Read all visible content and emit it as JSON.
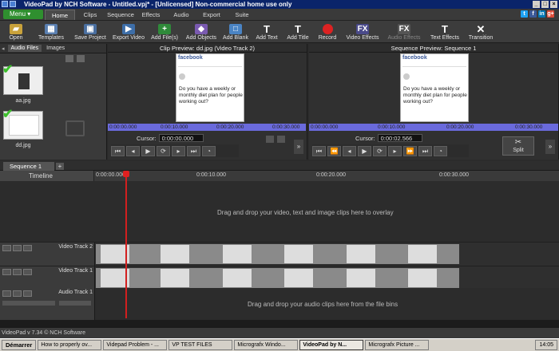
{
  "window": {
    "title": "VideoPad by NCH Software - Untitled.vpj* - [Unlicensed] Non-commercial home use only",
    "controls": [
      "_",
      "□",
      "×"
    ]
  },
  "menubar": {
    "menu_label": "Menu ▾",
    "tabs": [
      "Home",
      "Clips",
      "Sequence",
      "Effects",
      "Audio",
      "Export",
      "Suite"
    ],
    "social": [
      "t",
      "f",
      "in",
      "g+"
    ]
  },
  "toolbar": {
    "items": [
      "Open",
      "Templates",
      "Save Project",
      "Export Video",
      "Add File(s)",
      "Add Objects",
      "Add Blank",
      "Add Text",
      "Add Title",
      "Record",
      "Video Effects",
      "Audio Effects",
      "Text Effects",
      "Transition"
    ]
  },
  "filebin": {
    "tabs": [
      "Audio Files",
      "Images"
    ],
    "files": [
      "aa.jpg",
      "dd.jpg"
    ]
  },
  "clip_preview": {
    "title": "Clip Preview: dd.jpg (Video Track 2)",
    "ruler": [
      "0:00:00.000",
      "0:00:10.000",
      "0:00:20.000",
      "0:00:30.000"
    ],
    "cursor_label": "Cursor:",
    "cursor_value": "0:00:00.000"
  },
  "seq_preview": {
    "title": "Sequence Preview: Sequence 1",
    "ruler": [
      "0:00:00.000",
      "0:00:10.000",
      "0:00:20.000",
      "0:00:30.000"
    ],
    "cursor_label": "Cursor:",
    "cursor_value": "0:00:02.566",
    "split_label": "Split"
  },
  "preview_image": {
    "brand": "facebook",
    "text": "Do you have a weekly or monthly diet plan for people working out?"
  },
  "sequence": {
    "tab": "Sequence 1",
    "timeline_label": "Timeline",
    "ticks": [
      "0:00:00.000",
      "0:00:10.000",
      "0:00:20.000",
      "0:00:30.000"
    ]
  },
  "tracks": {
    "video2": "Video Track 2",
    "video1": "Video Track 1",
    "audio1": "Audio Track 1"
  },
  "messages": {
    "overlay": "Drag and drop your video, text and image clips here to overlay",
    "audio": "Drag and drop your audio clips here from the file bins"
  },
  "status": {
    "version": "VideoPad v 7.34 © NCH Software"
  },
  "taskbar": {
    "start": "Démarrer",
    "tasks": [
      "How to properly ov...",
      "Videpad Problem - ...",
      "VP TEST FILES",
      "Micrografx Windo...",
      "VideoPad by N...",
      "Micrografx Picture ..."
    ],
    "clock": "14:05"
  }
}
